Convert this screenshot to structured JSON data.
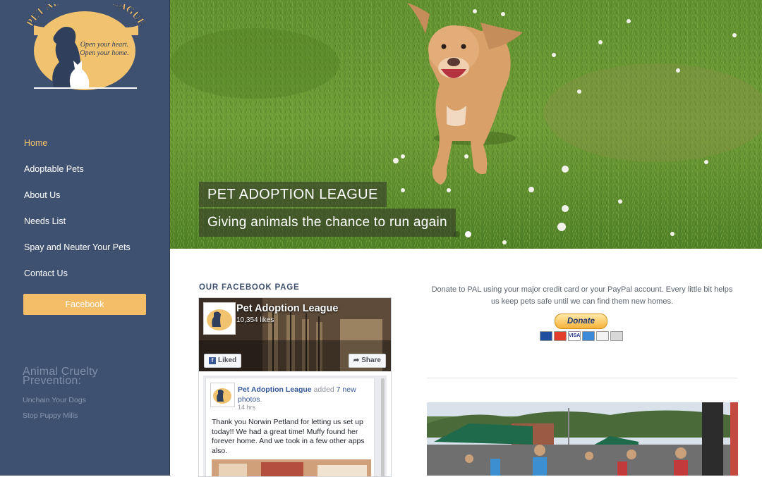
{
  "logo": {
    "arc_text": "PET ADOPTION LEAGUE",
    "tagline_1": "Open your heart.",
    "tagline_2": "Open your home."
  },
  "nav": {
    "items": [
      "Home",
      "Adoptable Pets",
      "About Us",
      "Needs List",
      "Spay and Neuter Your Pets",
      "Contact Us"
    ],
    "active": "Home",
    "facebook_button": "Facebook"
  },
  "cruelty": {
    "title": "Animal Cruelty Prevention:",
    "links": [
      "Unchain Your Dogs",
      "Stop Puppy Mills"
    ]
  },
  "hero": {
    "title": "PET ADOPTION LEAGUE",
    "subtitle": "Giving animals the chance to run again",
    "slides_total": 2,
    "active_slide": 2
  },
  "facebook_section": {
    "heading": "OUR FACEBOOK PAGE",
    "page_name": "Pet Adoption League",
    "likes": "10,354 likes",
    "liked_label": "Liked",
    "share_label": "Share",
    "post": {
      "author": "Pet Adoption League",
      "action": "added",
      "action_link": "7 new photos",
      "time": "14 hrs",
      "text": "Thank you Norwin Petland for letting us set up today!! We had a great time! Muffy found her forever home. And we took in a few other apps also."
    }
  },
  "donate": {
    "text": "Donate to PAL using your major credit card or your PayPal account. Every little bit helps us keep pets safe until we can find them new homes.",
    "button_label": "Donate",
    "card_logos": [
      "maestro",
      "mastercard",
      "visa",
      "amex",
      "discover",
      "bank"
    ]
  },
  "colors": {
    "sidebar": "#3f5170",
    "accent_orange": "#f4bd68",
    "active_nav": "#f2c36e",
    "facebook_blue": "#365899"
  }
}
